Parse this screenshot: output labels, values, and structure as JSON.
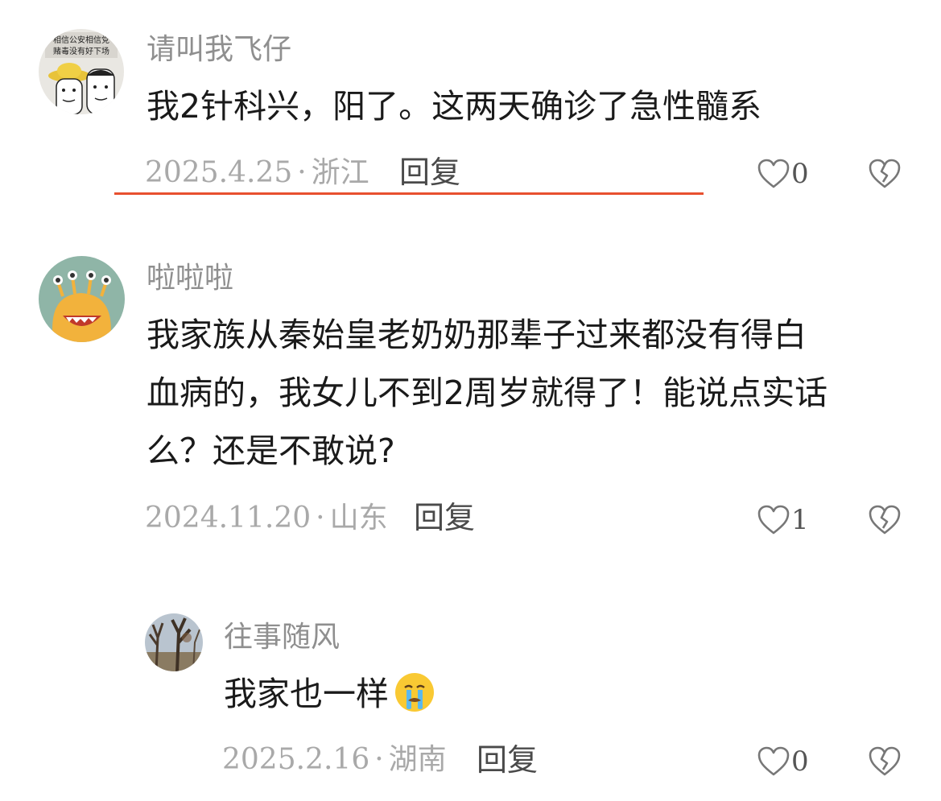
{
  "comments": [
    {
      "username": "请叫我飞仔",
      "avatar_caption": [
        "相信公安相信党",
        "赌毒没有好下场"
      ],
      "text": "我2针科兴，阳了。这两天确诊了急性髓系",
      "date": "2025.4.25",
      "location": "浙江",
      "reply_label": "回复",
      "likes": "0"
    },
    {
      "username": "啦啦啦",
      "text_lines": [
        "我家族从秦始皇老奶奶那辈子过来都没有得白",
        "血病的，我女儿不到2周岁就得了！能说点实话",
        "么？还是不敢说?"
      ],
      "date": "2024.11.20",
      "location": "山东",
      "reply_label": "回复",
      "likes": "1"
    },
    {
      "username": "往事随风",
      "text": "我家也一样",
      "emoji": "crying-face",
      "date": "2025.2.16",
      "location": "湖南",
      "reply_label": "回复",
      "likes": "0"
    }
  ],
  "colors": {
    "underline": "#e8502f",
    "username": "#8f8f8f",
    "meta": "#a9a9a9"
  },
  "icons": {
    "like": "heart-outline-icon",
    "dislike": "broken-heart-icon"
  }
}
